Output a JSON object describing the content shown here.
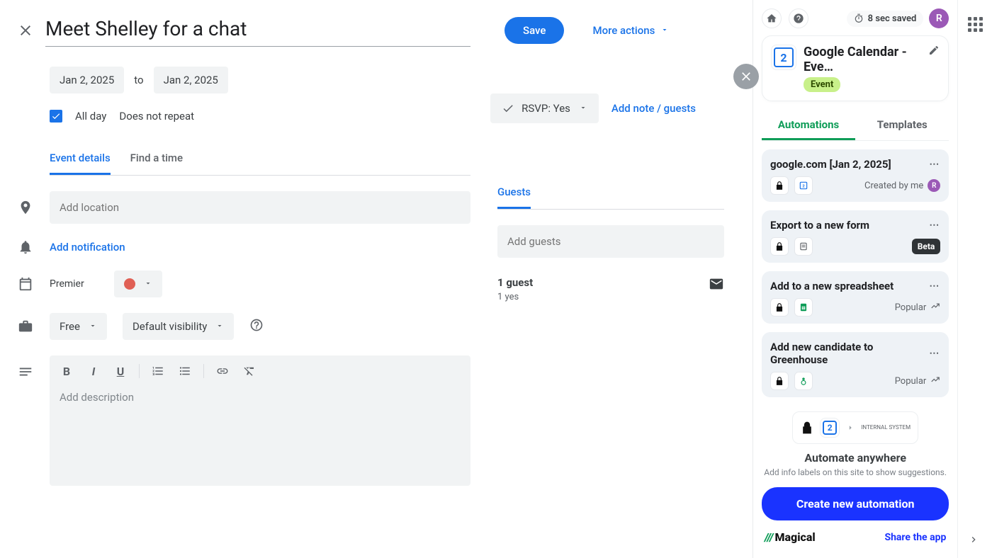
{
  "header": {
    "title": "Meet Shelley for a chat",
    "save_label": "Save",
    "more_actions_label": "More actions"
  },
  "dates": {
    "start": "Jan 2, 2025",
    "to_label": "to",
    "end": "Jan 2, 2025"
  },
  "allday": {
    "checked": true,
    "label": "All day",
    "repeat_label": "Does not repeat"
  },
  "rsvp": {
    "label": "RSVP: Yes",
    "add_note_label": "Add note / guests"
  },
  "tabs": {
    "event_details": "Event details",
    "find_time": "Find a time"
  },
  "location": {
    "placeholder": "Add location"
  },
  "notification": {
    "label": "Add notification"
  },
  "calendar": {
    "name": "Premier",
    "color": "#e06055"
  },
  "availability": {
    "free_label": "Free",
    "visibility_label": "Default visibility"
  },
  "description": {
    "placeholder": "Add description"
  },
  "guests": {
    "tab_label": "Guests",
    "input_placeholder": "Add guests",
    "count_label": "1 guest",
    "yes_label": "1 yes"
  },
  "panel": {
    "saved_label": "8 sec saved",
    "avatar_initial": "R",
    "title": "Google Calendar - Eve…",
    "badge": "Event",
    "cal_day": "2",
    "tabs": {
      "automations": "Automations",
      "templates": "Templates"
    },
    "cards": [
      {
        "title": "google.com [Jan 2, 2025]",
        "meta_label": "Created by me",
        "meta_type": "creator"
      },
      {
        "title": "Export to a new form",
        "meta_label": "Beta",
        "meta_type": "beta"
      },
      {
        "title": "Add to a new spreadsheet",
        "meta_label": "Popular",
        "meta_type": "popular"
      },
      {
        "title": "Add new candidate to Greenhouse",
        "meta_label": "Popular",
        "meta_type": "popular"
      }
    ],
    "anywhere": {
      "system_label": "INTERNAL SYSTEM",
      "title": "Automate anywhere",
      "desc": "Add info labels on this site to show suggestions."
    },
    "create_label": "Create new automation",
    "brand": "Magical",
    "share_label": "Share the app"
  }
}
